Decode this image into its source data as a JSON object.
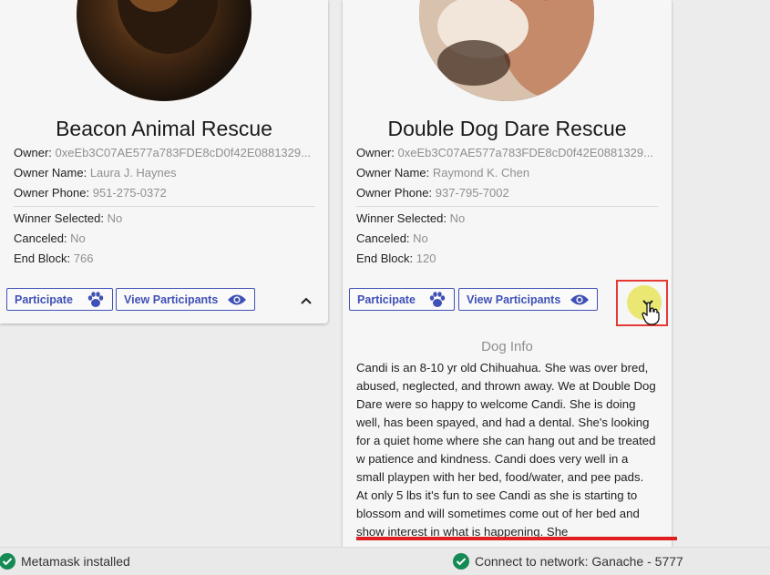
{
  "cards": [
    {
      "title": "Beacon Animal Rescue",
      "owner_label": "Owner:",
      "owner_value": "0xeEb3C07AE577a783FDE8cD0f42E0881329...",
      "owner_name_label": "Owner Name:",
      "owner_name_value": "Laura J. Haynes",
      "owner_phone_label": "Owner Phone:",
      "owner_phone_value": "951-275-0372",
      "winner_label": "Winner Selected:",
      "winner_value": "No",
      "canceled_label": "Canceled:",
      "canceled_value": "No",
      "end_block_label": "End Block:",
      "end_block_value": "766",
      "participate_label": "Participate",
      "view_participants_label": "View Participants",
      "expand_icon": "chevron-up-icon"
    },
    {
      "title": "Double Dog Dare Rescue",
      "owner_label": "Owner:",
      "owner_value": "0xeEb3C07AE577a783FDE8cD0f42E0881329...",
      "owner_name_label": "Owner Name:",
      "owner_name_value": "Raymond K. Chen",
      "owner_phone_label": "Owner Phone:",
      "owner_phone_value": "937-795-7002",
      "winner_label": "Winner Selected:",
      "winner_value": "No",
      "canceled_label": "Canceled:",
      "canceled_value": "No",
      "end_block_label": "End Block:",
      "end_block_value": "120",
      "participate_label": "Participate",
      "view_participants_label": "View Participants",
      "expand_icon": "chevron-down-icon",
      "dog_info_title": "Dog Info",
      "dog_info_text": "Candi is an 8-10 yr old Chihuahua. She was over bred, abused, neglected, and thrown away. We at Double Dog Dare were so happy to welcome Candi. She is doing well, has been spayed, and had a dental. She's looking for a quiet home where she can hang out and be treated w patience and kindness. Candi does very well in a small playpen with her bed, food/water, and pee pads. At only 5 lbs it's fun to see Candi as she is starting to blossom and will sometimes come out of her bed and show interest in what is happening. She"
    }
  ],
  "status": {
    "metamask": "Metamask installed",
    "network": "Connect to network: Ganache - 5777"
  },
  "colors": {
    "accent": "#3f51b5",
    "status_ok": "#168a55",
    "annotation_red": "#e53935",
    "cursor_highlight": "#e8e45a"
  }
}
